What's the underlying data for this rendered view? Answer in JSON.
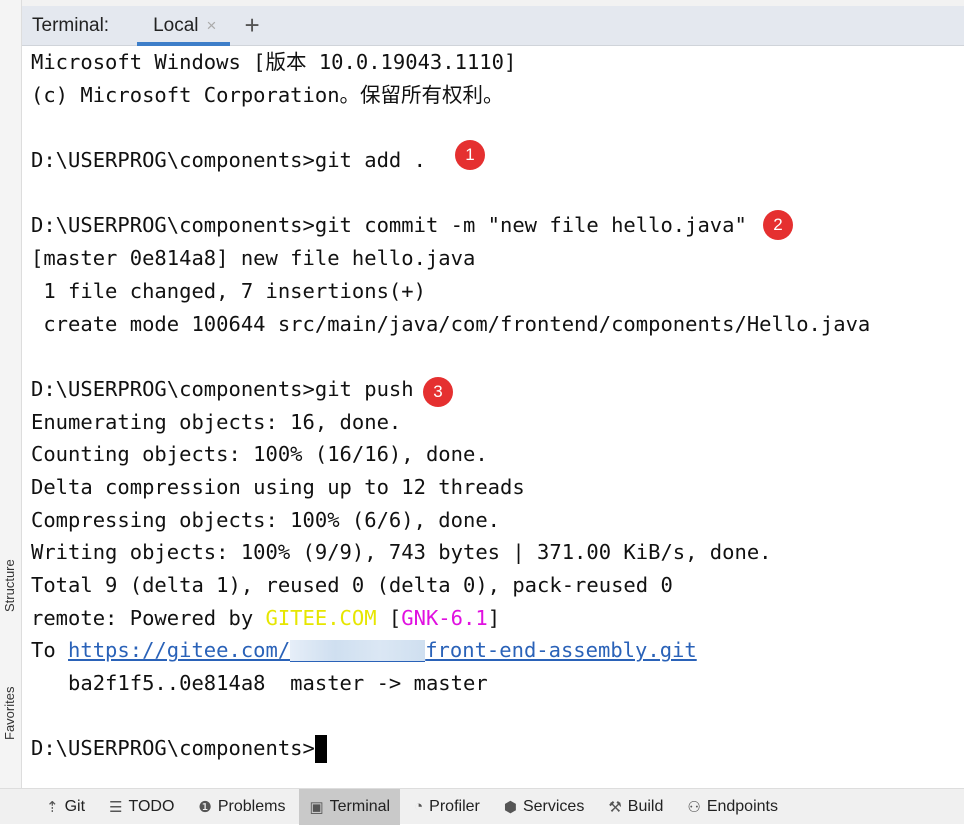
{
  "sidebar": {
    "structure": "Structure",
    "favorites": "Favorites"
  },
  "header": {
    "label": "Terminal:",
    "tab": "Local",
    "close": "×",
    "add": "+"
  },
  "terminal": {
    "lines": [
      "Microsoft Windows [版本 10.0.19043.1110]",
      "(c) Microsoft Corporation。保留所有权利。",
      "",
      "D:\\USERPROG\\components>git add .",
      "",
      "D:\\USERPROG\\components>git commit -m \"new file hello.java\"",
      "[master 0e814a8] new file hello.java",
      " 1 file changed, 7 insertions(+)",
      " create mode 100644 src/main/java/com/frontend/components/Hello.java",
      "",
      "D:\\USERPROG\\components>git push",
      "Enumerating objects: 16, done.",
      "Counting objects: 100% (16/16), done.",
      "Delta compression using up to 12 threads",
      "Compressing objects: 100% (6/6), done.",
      "Writing objects: 100% (9/9), 743 bytes | 371.00 KiB/s, done.",
      "Total 9 (delta 1), reused 0 (delta 0), pack-reused 0"
    ],
    "remote": {
      "prefix": "remote: Powered by ",
      "gitee": "GITEE.COM",
      "open": " [",
      "gnk": "GNK-6.1",
      "close": "]"
    },
    "to": {
      "prefix": "To ",
      "link_start": "https://gitee.com/",
      "link_end": "front-end-assembly.git"
    },
    "update": "   ba2f1f5..0e814a8  master -> master",
    "prompt": "D:\\USERPROG\\components>"
  },
  "badges": [
    "1",
    "2",
    "3"
  ],
  "toolwindows": [
    {
      "icon": "git-icon",
      "glyph": "⇡",
      "label": "Git"
    },
    {
      "icon": "todo-icon",
      "glyph": "☰",
      "label": "TODO"
    },
    {
      "icon": "problems-icon",
      "glyph": "❶",
      "label": "Problems"
    },
    {
      "icon": "terminal-icon",
      "glyph": "▣",
      "label": "Terminal",
      "active": true
    },
    {
      "icon": "profiler-icon",
      "glyph": "◔",
      "label": "Profiler"
    },
    {
      "icon": "services-icon",
      "glyph": "⬢",
      "label": "Services"
    },
    {
      "icon": "build-icon",
      "glyph": "⚒",
      "label": "Build"
    },
    {
      "icon": "endpoints-icon",
      "glyph": "⚇",
      "label": "Endpoints"
    }
  ],
  "colors": {
    "accent": "#3d7ec9",
    "badge": "#e53030",
    "gitee": "#e6e600",
    "gnk": "#e010e0",
    "link": "#2a62b8"
  }
}
